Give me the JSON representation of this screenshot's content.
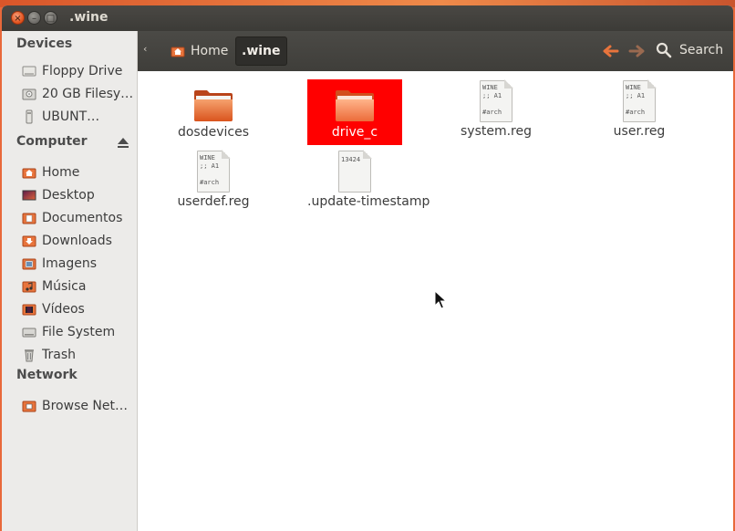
{
  "window": {
    "title": ".wine",
    "close_glyph": "×",
    "min_glyph": "–",
    "max_glyph": "□"
  },
  "sidebar": {
    "sections": [
      {
        "heading": "Devices",
        "items": [
          {
            "label": "Floppy Drive",
            "icon": "floppy-icon"
          },
          {
            "label": "20 GB Filesy…",
            "icon": "harddisk-icon"
          },
          {
            "label": "UBUNT…",
            "icon": "usb-drive-icon"
          }
        ]
      },
      {
        "heading": "Computer",
        "items": [
          {
            "label": "Home",
            "icon": "home-folder-icon"
          },
          {
            "label": "Desktop",
            "icon": "desktop-icon"
          },
          {
            "label": "Documentos",
            "icon": "documents-folder-icon"
          },
          {
            "label": "Downloads",
            "icon": "downloads-folder-icon"
          },
          {
            "label": "Imagens",
            "icon": "pictures-folder-icon"
          },
          {
            "label": "Música",
            "icon": "music-folder-icon"
          },
          {
            "label": "Vídeos",
            "icon": "videos-folder-icon"
          },
          {
            "label": "File System",
            "icon": "filesystem-icon"
          },
          {
            "label": "Trash",
            "icon": "trash-icon"
          }
        ]
      },
      {
        "heading": "Network",
        "items": [
          {
            "label": "Browse Net…",
            "icon": "network-icon"
          }
        ]
      }
    ]
  },
  "toolbar": {
    "breadcrumb": [
      {
        "label": "Home"
      },
      {
        "label": ".wine"
      }
    ],
    "search_label": "Search"
  },
  "files": [
    {
      "name": "dosdevices",
      "type": "folder",
      "selected": false
    },
    {
      "name": "drive_c",
      "type": "folder",
      "selected": true
    },
    {
      "name": "system.reg",
      "type": "document",
      "preview": "WINE\n;; A1\n\n#arch"
    },
    {
      "name": "user.reg",
      "type": "document",
      "preview": "WINE\n;; A1\n\n#arch"
    },
    {
      "name": "userdef.reg",
      "type": "document",
      "preview": "WINE\n;; A1\n\n#arch"
    },
    {
      "name": ".update-timestamp",
      "type": "document",
      "preview": "13424"
    }
  ],
  "colors": {
    "accent": "#dd4814",
    "selection": "#ff0000",
    "toolbar": "#3f3e3a"
  }
}
